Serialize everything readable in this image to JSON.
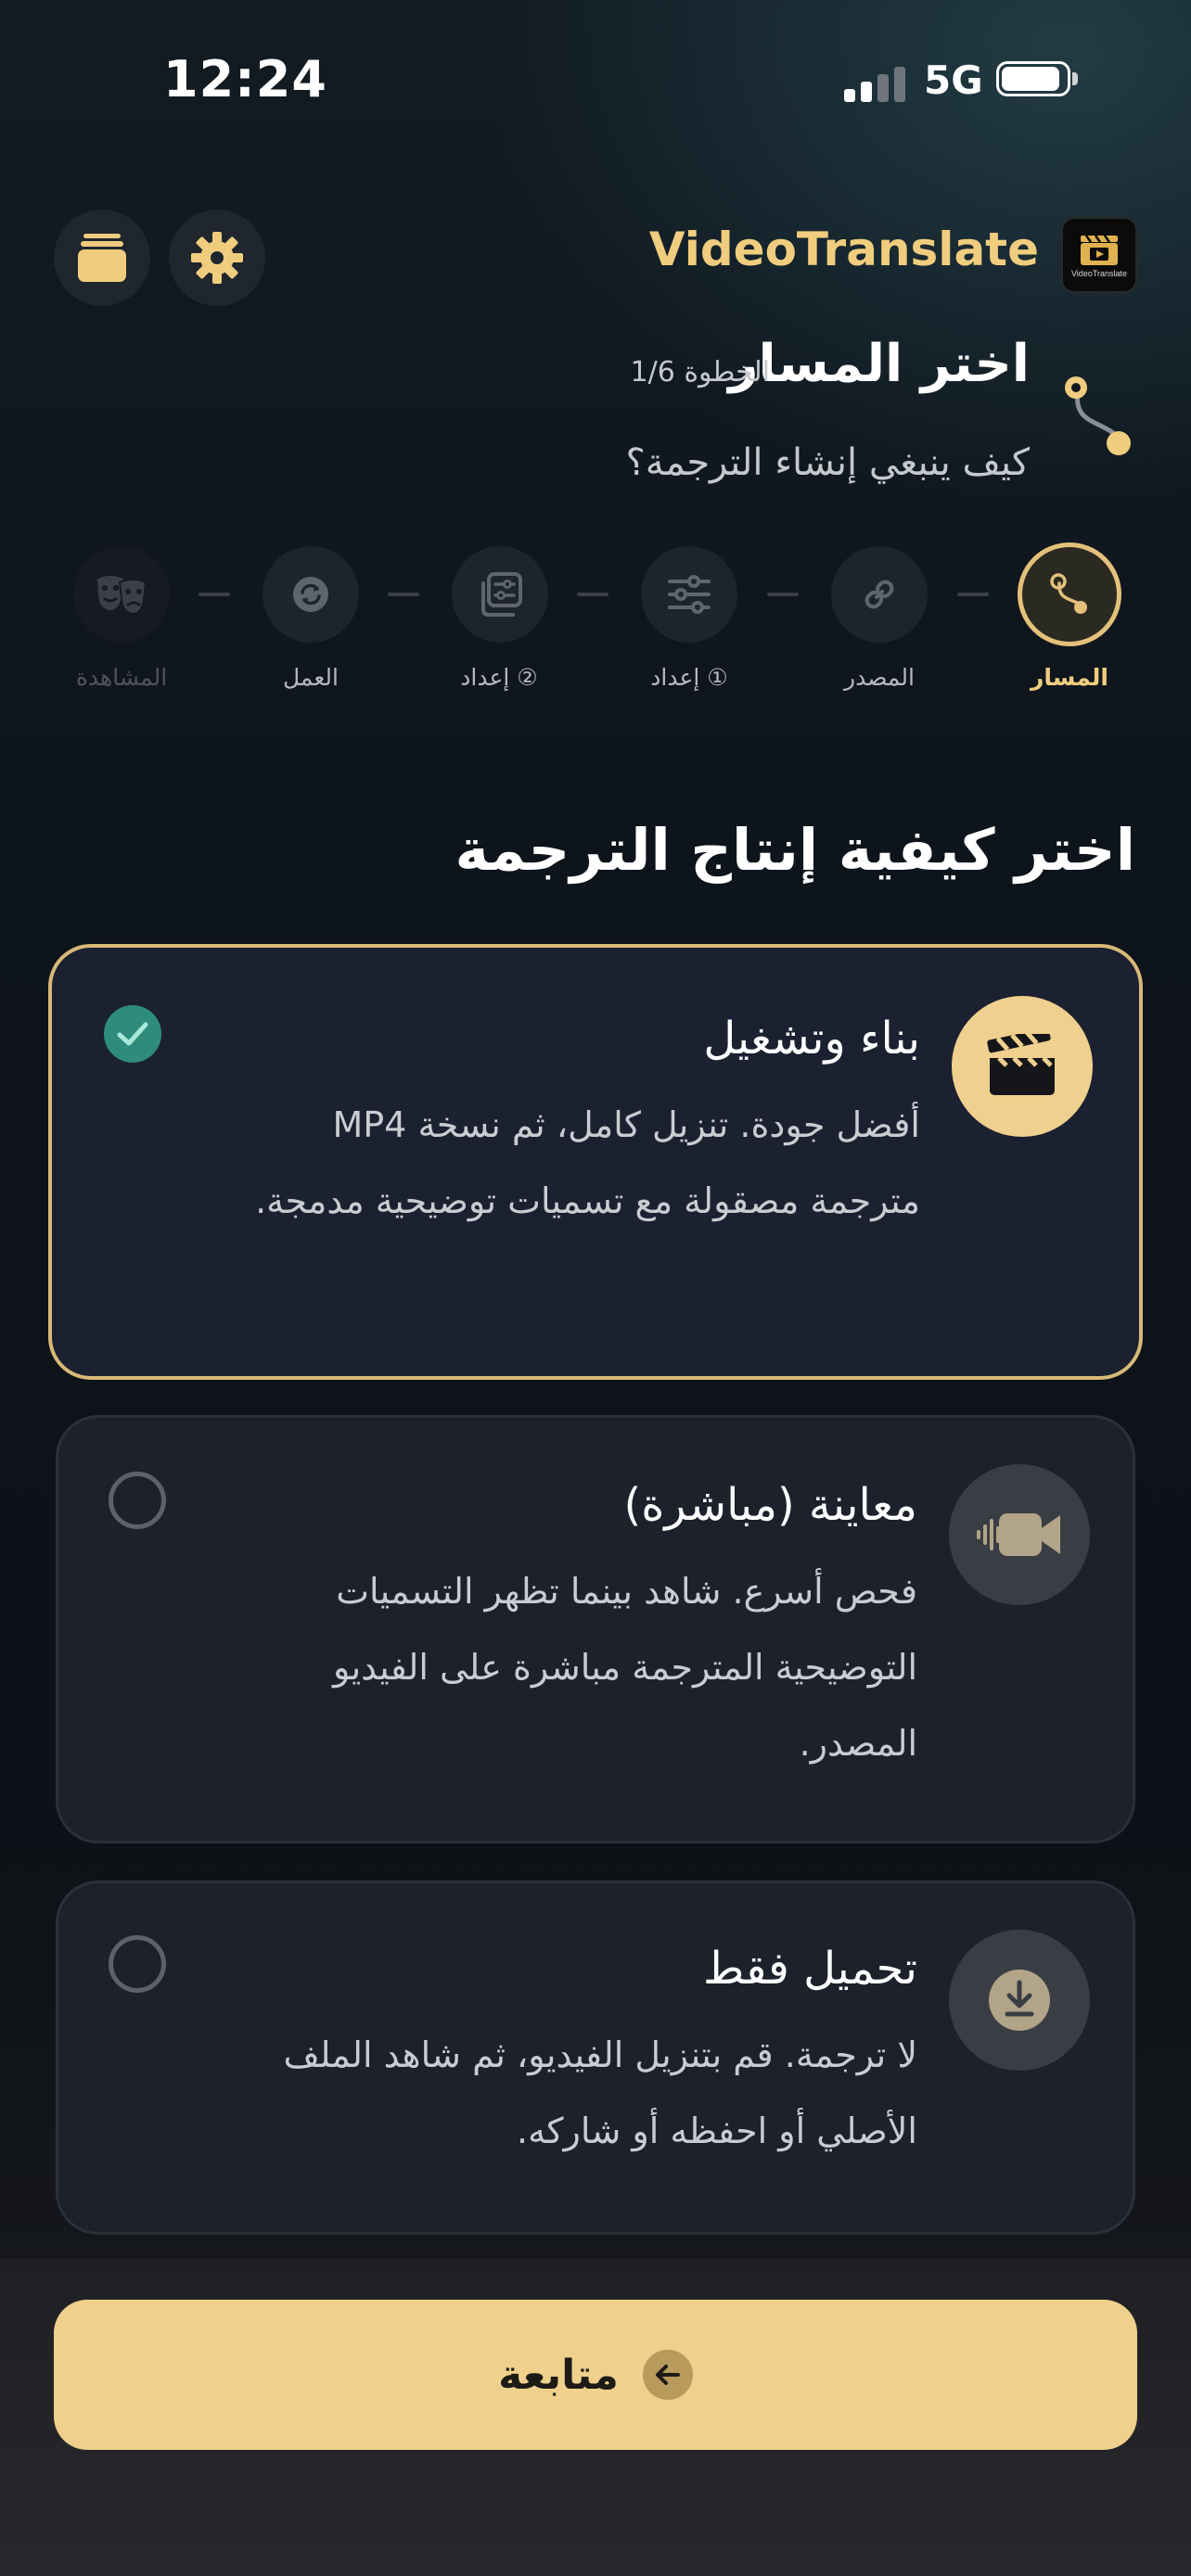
{
  "status_bar": {
    "time": "12:24",
    "network": "5G"
  },
  "header": {
    "brand_name": "VideoTranslate",
    "logo_caption": "VideoTranslate",
    "settings_icon": "gear-icon",
    "library_icon": "stack-icon"
  },
  "step": {
    "title": "اختر المسار",
    "count": "الخطوة 1/6",
    "subtitle": "كيف ينبغي إنشاء الترجمة؟"
  },
  "stepper": {
    "steps": [
      {
        "label": "المسار",
        "icon": "route-icon",
        "state": "active"
      },
      {
        "label": "المصدر",
        "icon": "link-icon",
        "state": "upcoming"
      },
      {
        "label": "إعداد ①",
        "icon": "sliders-icon",
        "state": "upcoming"
      },
      {
        "label": "إعداد ②",
        "icon": "config-icon",
        "state": "upcoming"
      },
      {
        "label": "العمل",
        "icon": "refresh-icon",
        "state": "upcoming"
      },
      {
        "label": "المشاهدة",
        "icon": "theater-masks-icon",
        "state": "disabled"
      }
    ]
  },
  "section_title": "اختر كيفية إنتاج الترجمة",
  "options": [
    {
      "title": "بناء وتشغيل",
      "description": "أفضل جودة. تنزيل كامل، ثم نسخة MP4 مترجمة مصقولة مع تسميات توضيحية مدمجة.",
      "icon": "clapperboard-icon",
      "selected": true
    },
    {
      "title": "معاينة (مباشرة)",
      "description": "فحص أسرع. شاهد بينما تظهر التسميات التوضيحية المترجمة مباشرة على الفيديو المصدر.",
      "icon": "live-video-icon",
      "selected": false
    },
    {
      "title": "تحميل فقط",
      "description": "لا ترجمة. قم بتنزيل الفيديو، ثم شاهد الملف الأصلي أو احفظه أو شاركه.",
      "icon": "download-icon",
      "selected": false
    }
  ],
  "footer": {
    "continue_label": "متابعة"
  },
  "colors": {
    "accent": "#efd08c",
    "accent_text": "#f0cd7e",
    "card_bg": "#1c212c",
    "check_teal": "#2f8c7d"
  }
}
